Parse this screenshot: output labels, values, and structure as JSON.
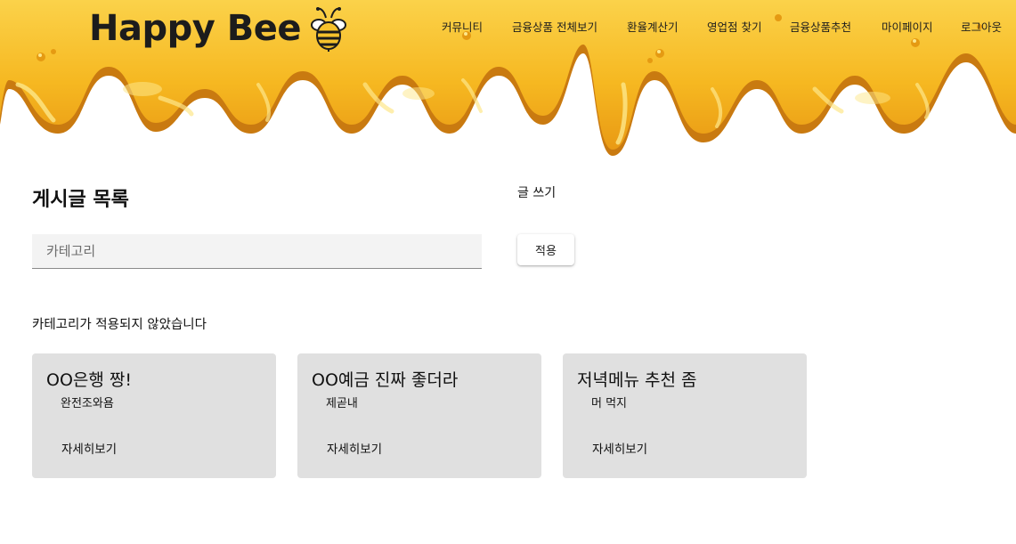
{
  "brand": {
    "logo_text": "Happy Bee",
    "honey_color": "#f6b821",
    "honey_dark": "#d98c12",
    "honey_light": "#fde47a"
  },
  "nav": {
    "items": [
      {
        "label": "커뮤니티"
      },
      {
        "label": "금융상품 전체보기"
      },
      {
        "label": "환율계산기"
      },
      {
        "label": "영업점 찾기"
      },
      {
        "label": "금융상품추천"
      },
      {
        "label": "마이페이지"
      },
      {
        "label": "로그아웃"
      }
    ]
  },
  "board": {
    "title": "게시글 목록",
    "write_label": "글 쓰기",
    "category_placeholder": "카테고리",
    "category_value": "",
    "apply_label": "적용",
    "status_message": "카테고리가 적용되지 않았습니다"
  },
  "posts": [
    {
      "title": "OO은행 짱!",
      "content": "완전조와욤",
      "more_label": "자세히보기"
    },
    {
      "title": "OO예금 진짜 좋더라",
      "content": "제곧내",
      "more_label": "자세히보기"
    },
    {
      "title": "저녁메뉴 추천 좀",
      "content": "머 먹지",
      "more_label": "자세히보기"
    }
  ],
  "icons": {
    "logo_icon": "bee-icon"
  }
}
